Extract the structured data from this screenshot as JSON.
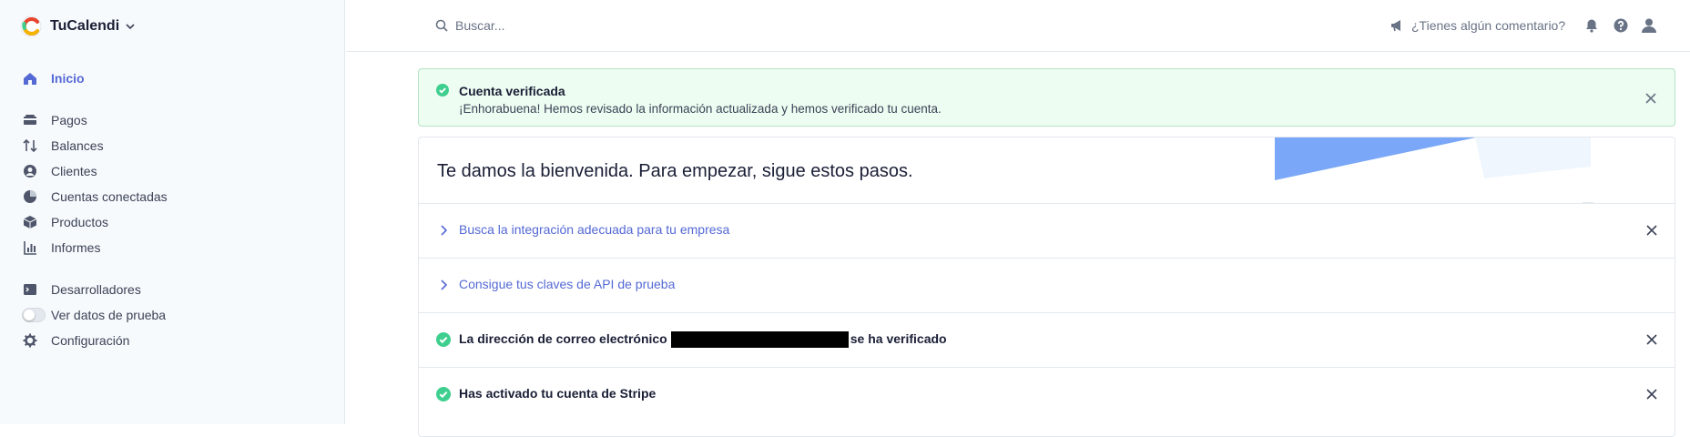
{
  "app": {
    "name": "TuCalendi"
  },
  "sidebar": {
    "items": [
      {
        "label": "Inicio",
        "icon": "home-icon",
        "active": true
      },
      {
        "label": "Pagos",
        "icon": "payments-icon"
      },
      {
        "label": "Balances",
        "icon": "balances-icon"
      },
      {
        "label": "Clientes",
        "icon": "customers-icon"
      },
      {
        "label": "Cuentas conectadas",
        "icon": "connected-accounts-icon"
      },
      {
        "label": "Productos",
        "icon": "products-icon"
      },
      {
        "label": "Informes",
        "icon": "reports-icon"
      },
      {
        "label": "Desarrolladores",
        "icon": "developers-icon"
      },
      {
        "label": "Ver datos de prueba",
        "icon": "toggle"
      },
      {
        "label": "Configuración",
        "icon": "gear-icon"
      }
    ]
  },
  "topbar": {
    "search_placeholder": "Buscar...",
    "feedback_label": "¿Tienes algún comentario?"
  },
  "banner": {
    "title": "Cuenta verificada",
    "text": "¡Enhorabuena! Hemos revisado la información actualizada y hemos verificado tu cuenta."
  },
  "welcome": {
    "title": "Te damos la bienvenida. Para empezar, sigue estos pasos.",
    "steps": [
      {
        "label": "Busca la integración adecuada para tu empresa",
        "state": "collapsed"
      },
      {
        "label": "Consigue tus claves de API de prueba",
        "state": "collapsed"
      },
      {
        "label_before": "La dirección de correo electrónico",
        "label_after": "se ha verificado",
        "state": "done"
      },
      {
        "label": "Has activado tu cuenta de Stripe",
        "state": "done"
      }
    ]
  },
  "colors": {
    "accent": "#5469d4",
    "success": "#3ecf8e",
    "banner_bg": "#edfdf1"
  }
}
